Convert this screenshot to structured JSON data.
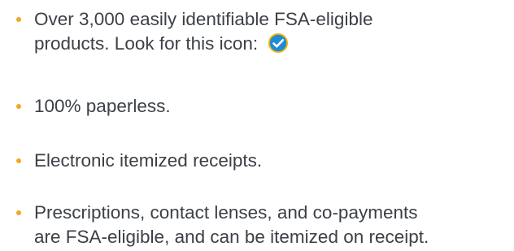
{
  "colors": {
    "bullet": "#f5a623",
    "text": "#3c4046",
    "check_fill": "#1f8ad6",
    "check_ring": "#f0b400",
    "check_mark": "#ffffff"
  },
  "icons": {
    "bullet": "orange-dot-icon",
    "eligible": "blue-checkmark-badge-icon"
  },
  "items": [
    {
      "line1": "Over 3,000 easily identifiable FSA-eligible",
      "line2": "products. Look for this icon:"
    },
    {
      "line1": "100% paperless."
    },
    {
      "line1": "Electronic itemized receipts."
    },
    {
      "line1": "Prescriptions, contact lenses, and co-payments",
      "line2": "are FSA-eligible, and can be itemized on receipt."
    }
  ]
}
